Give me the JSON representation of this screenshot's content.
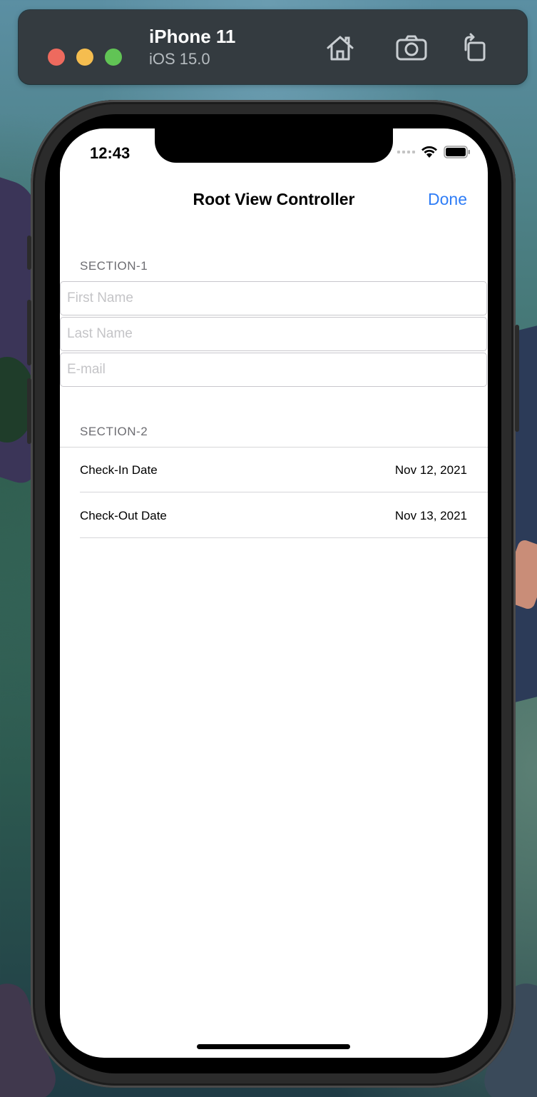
{
  "simulator": {
    "device_name": "iPhone 11",
    "os_version": "iOS 15.0",
    "icons": [
      "home-icon",
      "screenshot-icon",
      "rotate-icon"
    ]
  },
  "status_bar": {
    "time": "12:43"
  },
  "nav_bar": {
    "title": "Root View Controller",
    "done_label": "Done"
  },
  "section1": {
    "header": "SECTION-1",
    "fields": [
      {
        "placeholder": "First Name",
        "value": ""
      },
      {
        "placeholder": "Last Name",
        "value": ""
      },
      {
        "placeholder": "E-mail",
        "value": ""
      }
    ]
  },
  "section2": {
    "header": "SECTION-2",
    "rows": [
      {
        "label": "Check-In Date",
        "value": "Nov 12, 2021"
      },
      {
        "label": "Check-Out Date",
        "value": "Nov 13, 2021"
      }
    ]
  },
  "colors": {
    "accent": "#2f7df6",
    "toolbar_bg": "#343b40",
    "traffic_red": "#ee6a5e",
    "traffic_yellow": "#f5bd4f",
    "traffic_green": "#61c455"
  }
}
